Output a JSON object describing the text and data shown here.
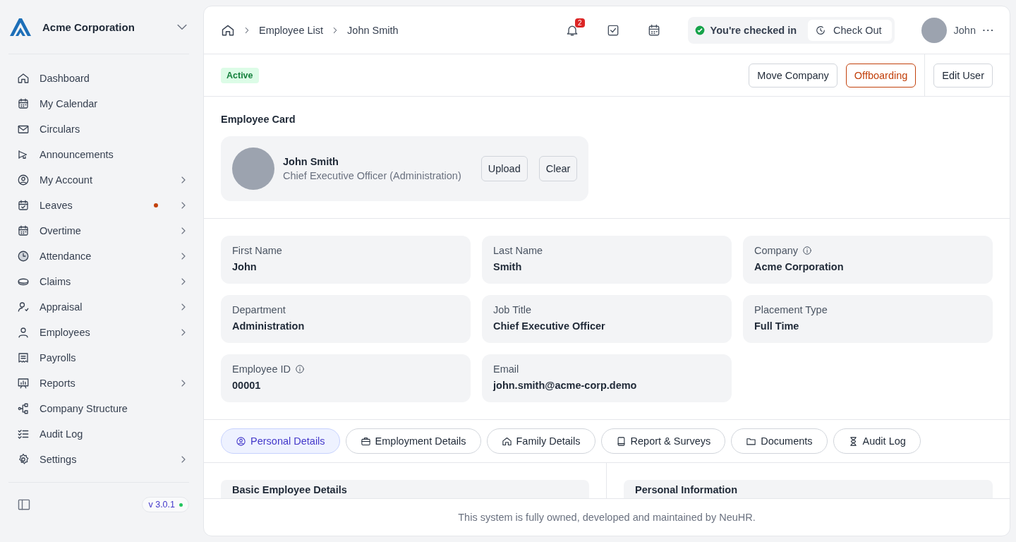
{
  "sidebar": {
    "company": "Acme Corporation",
    "items": [
      {
        "label": "Dashboard",
        "has_submenu": false,
        "notification": false
      },
      {
        "label": "My Calendar",
        "has_submenu": false,
        "notification": false
      },
      {
        "label": "Circulars",
        "has_submenu": false,
        "notification": false
      },
      {
        "label": "Announcements",
        "has_submenu": false,
        "notification": false
      },
      {
        "label": "My Account",
        "has_submenu": true,
        "notification": false
      },
      {
        "label": "Leaves",
        "has_submenu": true,
        "notification": true
      },
      {
        "label": "Overtime",
        "has_submenu": true,
        "notification": false
      },
      {
        "label": "Attendance",
        "has_submenu": true,
        "notification": false
      },
      {
        "label": "Claims",
        "has_submenu": true,
        "notification": false
      },
      {
        "label": "Appraisal",
        "has_submenu": true,
        "notification": false
      },
      {
        "label": "Employees",
        "has_submenu": true,
        "notification": false
      },
      {
        "label": "Payrolls",
        "has_submenu": false,
        "notification": false
      },
      {
        "label": "Reports",
        "has_submenu": true,
        "notification": false
      },
      {
        "label": "Company Structure",
        "has_submenu": false,
        "notification": false
      },
      {
        "label": "Audit Log",
        "has_submenu": false,
        "notification": false
      },
      {
        "label": "Settings",
        "has_submenu": true,
        "notification": false
      }
    ],
    "version": "v 3.0.1"
  },
  "header": {
    "breadcrumb": [
      "Employee List",
      "John Smith"
    ],
    "notification_count": "2",
    "check_in_status": "You're checked in",
    "check_out_button": "Check Out",
    "user_name": "John"
  },
  "actions": {
    "status": "Active",
    "buttons": [
      {
        "label": "Move Company",
        "kind": "default"
      },
      {
        "label": "Offboarding",
        "kind": "danger"
      },
      {
        "label": "Edit User",
        "kind": "default"
      }
    ]
  },
  "employee_card": {
    "title": "Employee Card",
    "name": "John Smith",
    "role": "Chief Executive Officer (Administration)",
    "buttons": [
      "Upload",
      "Clear"
    ]
  },
  "fields": [
    {
      "label": "First Name",
      "value": "John",
      "info": false
    },
    {
      "label": "Last Name",
      "value": "Smith",
      "info": false
    },
    {
      "label": "Company",
      "value": "Acme Corporation",
      "info": true
    },
    {
      "label": "Department",
      "value": "Administration",
      "info": false
    },
    {
      "label": "Job Title",
      "value": "Chief Executive Officer",
      "info": false
    },
    {
      "label": "Placement Type",
      "value": "Full Time",
      "info": false
    },
    {
      "label": "Employee ID",
      "value": "00001",
      "info": true
    },
    {
      "label": "Email",
      "value": "john.smith@acme-corp.demo",
      "info": false
    }
  ],
  "tabs": [
    {
      "label": "Personal Details",
      "selected": true
    },
    {
      "label": "Employment Details",
      "selected": false
    },
    {
      "label": "Family Details",
      "selected": false
    },
    {
      "label": "Report & Surveys",
      "selected": false
    },
    {
      "label": "Documents",
      "selected": false
    },
    {
      "label": "Audit Log",
      "selected": false
    }
  ],
  "sections": [
    "Basic Employee Details",
    "Personal Information"
  ],
  "footer": "This system is fully owned, developed and maintained by NeuHR."
}
